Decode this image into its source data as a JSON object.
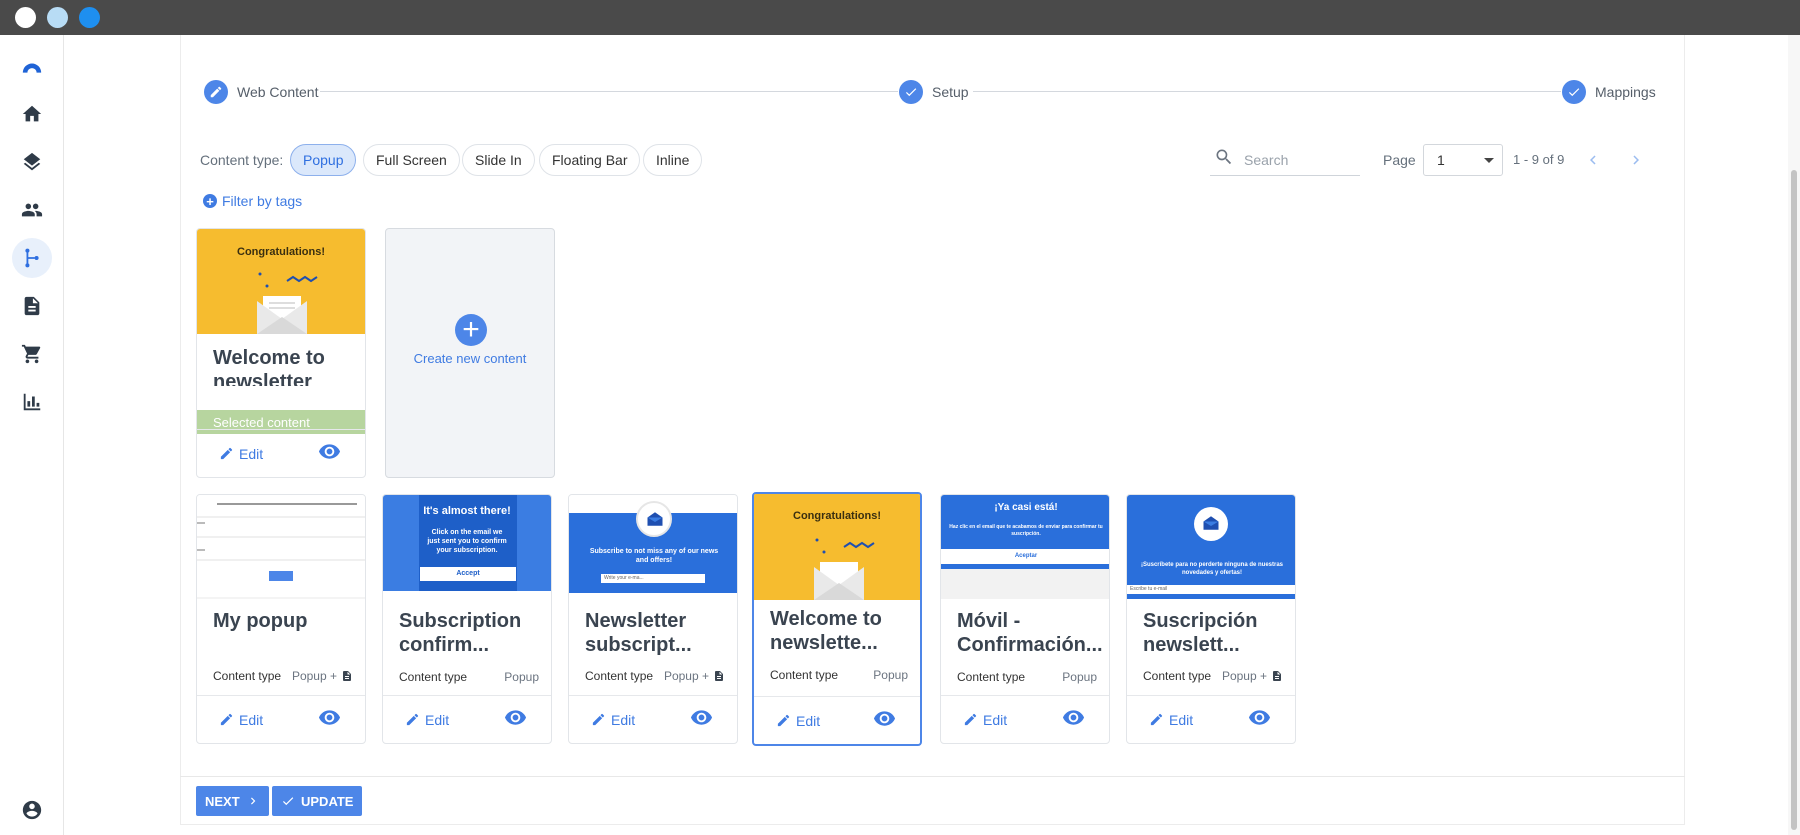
{
  "colors": {
    "accent": "#4d86e8",
    "selected_bar": "#b7d59f",
    "thumb_yellow": "#f6bc2f",
    "thumb_blue": "#2a6fdb"
  },
  "window": {
    "dots": [
      "#ffffff",
      "#b8dcf5",
      "#1e8ff0"
    ]
  },
  "sidebar": {
    "items": [
      {
        "icon": "logo-icon"
      },
      {
        "icon": "home-icon"
      },
      {
        "icon": "layers-icon"
      },
      {
        "icon": "people-icon"
      },
      {
        "icon": "flow-icon",
        "active": true
      },
      {
        "icon": "document-icon"
      },
      {
        "icon": "cart-icon"
      },
      {
        "icon": "bar-chart-icon"
      },
      {
        "icon": "account-icon"
      }
    ]
  },
  "stepper": {
    "steps": [
      {
        "label": "Web Content",
        "icon": "pencil-icon"
      },
      {
        "label": "Setup",
        "icon": "check-icon"
      },
      {
        "label": "Mappings",
        "icon": "check-icon"
      }
    ]
  },
  "filters": {
    "content_type_label": "Content type:",
    "chips": [
      {
        "label": "Popup",
        "active": true
      },
      {
        "label": "Full Screen"
      },
      {
        "label": "Slide In"
      },
      {
        "label": "Floating Bar"
      },
      {
        "label": "Inline"
      }
    ],
    "search_placeholder": "Search",
    "page_label": "Page",
    "page_value": "1",
    "page_range": "1 - 9 of 9",
    "filter_tags_label": "Filter by tags"
  },
  "selected_card": {
    "title": "Welcome to newsletter",
    "thumb_text": "Congratulations!",
    "selected_label": "Selected content",
    "edit_label": "Edit"
  },
  "create_card": {
    "label": "Create new content"
  },
  "cards": [
    {
      "title": "My popup",
      "ctype_label": "Content type",
      "ctype_value": "Popup +",
      "doc_icon": true,
      "edit_label": "Edit",
      "thumb": "form"
    },
    {
      "title": "Subscription confirm...",
      "ctype_label": "Content type",
      "ctype_value": "Popup",
      "doc_icon": false,
      "edit_label": "Edit",
      "thumb": "almost",
      "thumb_title": "It's almost there!",
      "thumb_body": "Click on the email we just sent you to confirm your subscription.",
      "thumb_btn": "Accept"
    },
    {
      "title": "Newsletter subscript...",
      "ctype_label": "Content type",
      "ctype_value": "Popup +",
      "doc_icon": true,
      "edit_label": "Edit",
      "thumb": "newsletter",
      "thumb_body": "Subscribe to not miss any of our news and offers!",
      "thumb_input": "Write your e-ma..."
    },
    {
      "title": "Welcome to newslette...",
      "ctype_label": "Content type",
      "ctype_value": "Popup",
      "doc_icon": false,
      "edit_label": "Edit",
      "thumb": "congrats",
      "thumb_title": "Congratulations!",
      "highlight": true
    },
    {
      "title": "Móvil - Confirmación...",
      "ctype_label": "Content type",
      "ctype_value": "Popup",
      "doc_icon": false,
      "edit_label": "Edit",
      "thumb": "movil",
      "thumb_title": "¡Ya casi está!",
      "thumb_body": "Haz clic en el email que te acabamos de enviar para confirmar tu suscripción.",
      "thumb_btn": "Aceptar"
    },
    {
      "title": "Suscripción newslett...",
      "ctype_label": "Content type",
      "ctype_value": "Popup +",
      "doc_icon": true,
      "edit_label": "Edit",
      "thumb": "suscripcion",
      "thumb_body": "¡Suscríbete para no perderte ninguna de nuestras novedades y ofertas!",
      "thumb_input": "Escribe tu e-mail"
    }
  ],
  "footer": {
    "next_label": "NEXT",
    "update_label": "UPDATE"
  }
}
